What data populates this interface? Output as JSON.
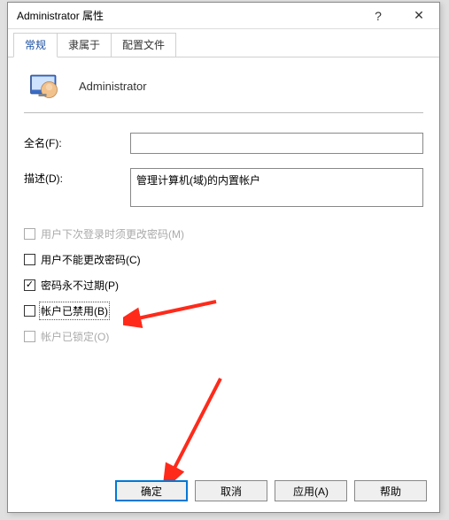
{
  "titlebar": {
    "title": "Administrator 属性",
    "help_symbol": "?",
    "close_symbol": "✕"
  },
  "tabs": {
    "general": "常规",
    "member_of": "隶属于",
    "profile": "配置文件"
  },
  "header": {
    "username": "Administrator"
  },
  "form": {
    "fullname_label": "全名(F):",
    "fullname_value": "",
    "description_label": "描述(D):",
    "description_value": "管理计算机(域)的内置帐户"
  },
  "checkboxes": {
    "must_change": "用户下次登录时须更改密码(M)",
    "cannot_change": "用户不能更改密码(C)",
    "never_expire": "密码永不过期(P)",
    "disabled": "帐户已禁用(B)",
    "locked": "帐户已锁定(O)"
  },
  "buttons": {
    "ok": "确定",
    "cancel": "取消",
    "apply": "应用(A)",
    "help": "帮助"
  }
}
